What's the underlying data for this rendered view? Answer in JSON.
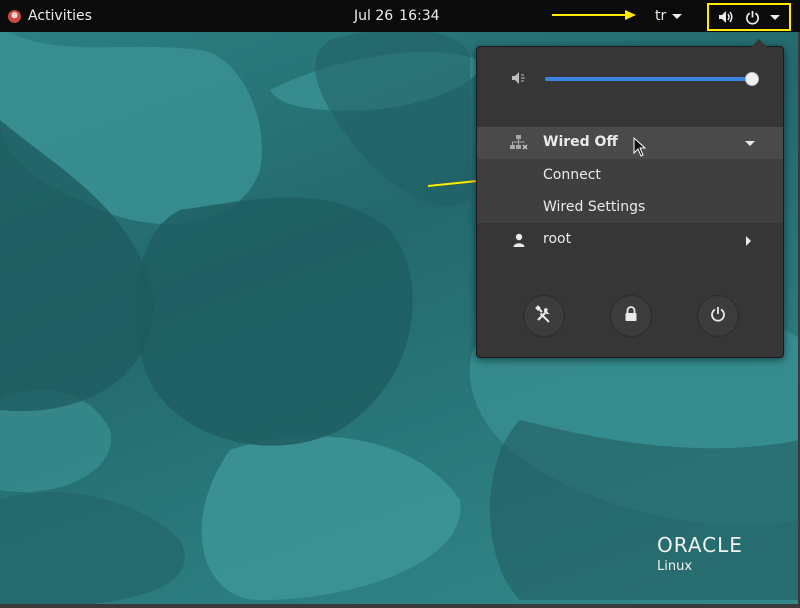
{
  "topbar": {
    "activities_label": "Activities",
    "date": "Jul 26",
    "time": "16:34",
    "input_source": "tr"
  },
  "menu": {
    "volume_level": 1.0,
    "network": {
      "label": "Wired Off",
      "submenu": [
        "Connect",
        "Wired Settings"
      ]
    },
    "user": {
      "label": "root"
    },
    "buttons": [
      "settings",
      "lock",
      "power-off"
    ]
  },
  "branding": {
    "name": "ORACLE",
    "product": "Linux"
  },
  "colors": {
    "annotation": "#ffea00",
    "slider": "#3b84e0",
    "panel": "#363636",
    "topbar": "#0b0b0b"
  }
}
